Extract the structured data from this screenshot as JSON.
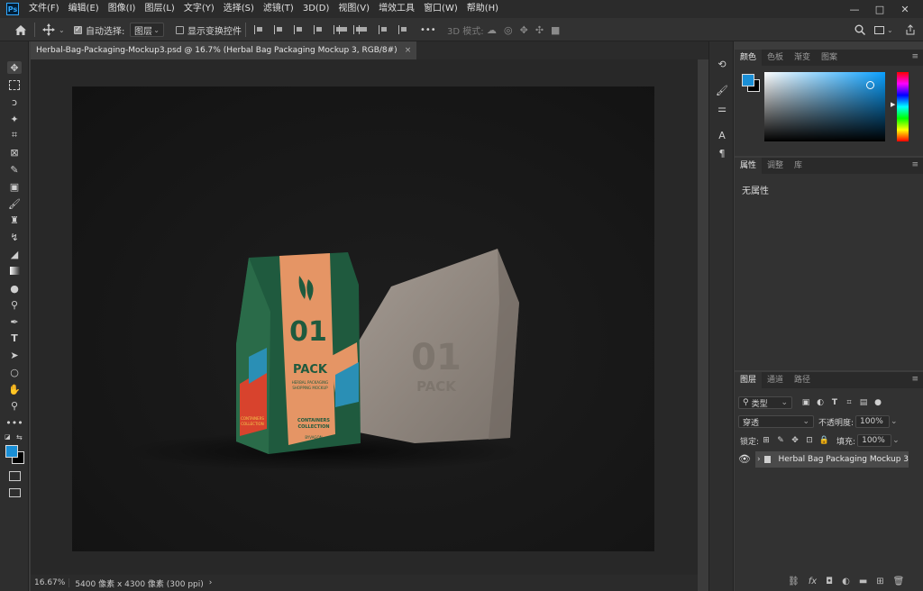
{
  "app": {
    "logo": "Ps",
    "brand_color": "#31a8ff"
  },
  "menu": [
    "文件(F)",
    "编辑(E)",
    "图像(I)",
    "图层(L)",
    "文字(Y)",
    "选择(S)",
    "滤镜(T)",
    "3D(D)",
    "视图(V)",
    "增效工具",
    "窗口(W)",
    "帮助(H)"
  ],
  "window_controls": {
    "minimize": "—",
    "maximize": "□",
    "close": "✕"
  },
  "options": {
    "auto_select_label": "自动选择:",
    "auto_select_value": "图层",
    "show_transform_label": "显示变换控件",
    "more": "•••",
    "mode_3d_label": "3D 模式:"
  },
  "document": {
    "tab_title": "Herbal-Bag-Packaging-Mockup3.psd @ 16.7% (Herbal Bag Packaging Mockup 3, RGB/8#)",
    "close": "×"
  },
  "artwork": {
    "bag": {
      "number": "01",
      "word": "PACK",
      "subtitle_1": "HERBAL PACKAGING",
      "subtitle_2": "SHOPPING MOCKUP",
      "label_1": "CONTAINERS",
      "label_2": "COLLECTION",
      "brand": "BYVAGON",
      "side_text_1": "CONTAINERS",
      "side_text_2": "COLLECTION"
    },
    "stone": {
      "number": "01",
      "word": "PACK"
    }
  },
  "status": {
    "zoom": "16.67%",
    "info": "5400 像素 x 4300 像素 (300 ppi)",
    "arrow": "›"
  },
  "color_panel": {
    "tabs": [
      "颜色",
      "色板",
      "渐变",
      "图案"
    ],
    "foreground": "#1a8fd6",
    "background": "#000000"
  },
  "properties_panel": {
    "tabs": [
      "属性",
      "调整",
      "库"
    ],
    "empty_text": "无属性"
  },
  "layers_panel": {
    "tabs": [
      "图层",
      "通道",
      "路径"
    ],
    "filter_label": "类型",
    "blend_mode": "穿透",
    "opacity_label": "不透明度:",
    "opacity_value": "100%",
    "lock_label": "锁定:",
    "fill_label": "填充:",
    "fill_value": "100%",
    "layers": [
      {
        "name": "Herbal Bag Packaging Mockup 3",
        "type": "group",
        "visible": true
      }
    ]
  }
}
